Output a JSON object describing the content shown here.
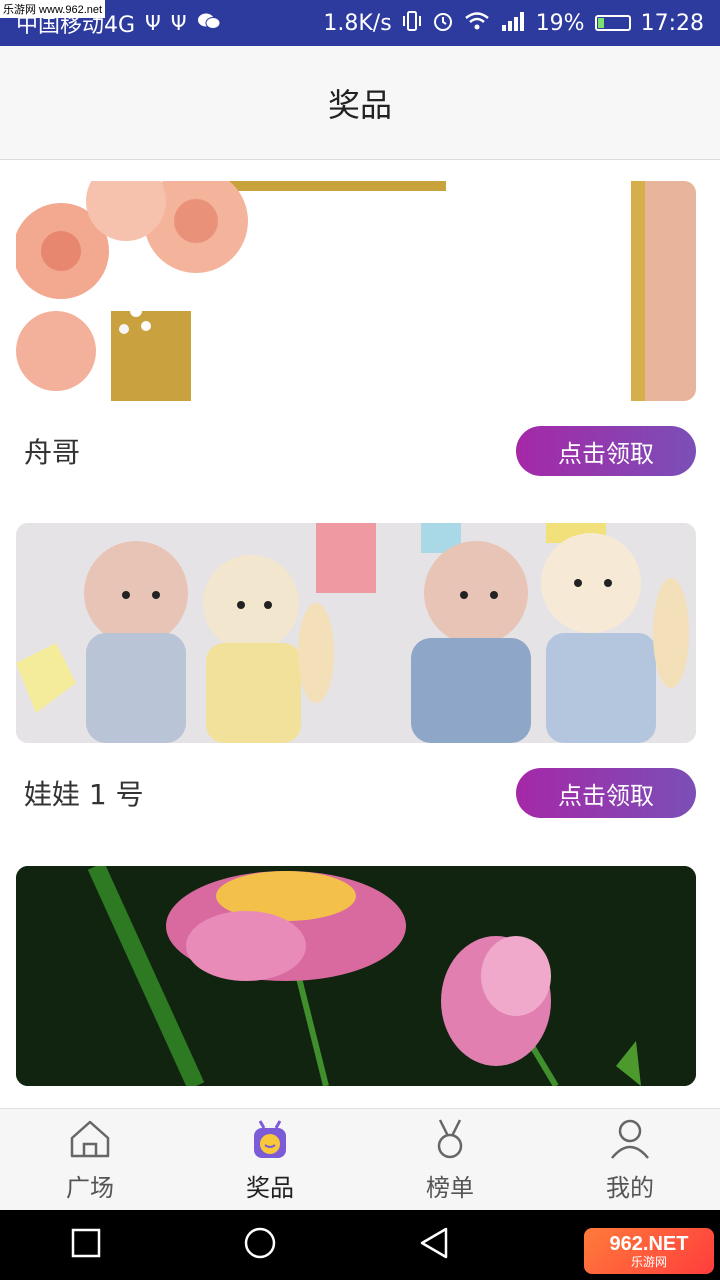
{
  "status_bar": {
    "carrier": "中国移动4G",
    "speed": "1.8K/s",
    "battery": "19%",
    "time": "17:28",
    "icons": [
      "usb-icon",
      "usb-icon",
      "wechat-icon",
      "vibrate-icon",
      "alarm-icon",
      "wifi-icon",
      "signal-icon",
      "battery-icon"
    ],
    "watermark": "乐游网 www.962.net"
  },
  "header": {
    "title": "奖品"
  },
  "prizes": [
    {
      "name": "舟哥",
      "button": "点击领取",
      "image": "roses-gold-frame-image"
    },
    {
      "name": "娃娃 1 号",
      "button": "点击领取",
      "image": "plush-dolls-image"
    },
    {
      "name": "",
      "button": "",
      "image": "lotus-flowers-image"
    }
  ],
  "tabbar": {
    "items": [
      {
        "label": "广场",
        "icon": "home-icon"
      },
      {
        "label": "奖品",
        "icon": "gift-icon"
      },
      {
        "label": "榜单",
        "icon": "medal-icon"
      },
      {
        "label": "我的",
        "icon": "user-icon"
      }
    ],
    "active": "奖品"
  },
  "system_nav": {
    "watermark_big": "962.NET",
    "watermark_small": "乐游网"
  },
  "colors": {
    "statusbar": "#2d3a9e",
    "button_start": "#a528a8",
    "button_end": "#7b4fb6",
    "active_tab_icon": "#7b5bd6"
  }
}
